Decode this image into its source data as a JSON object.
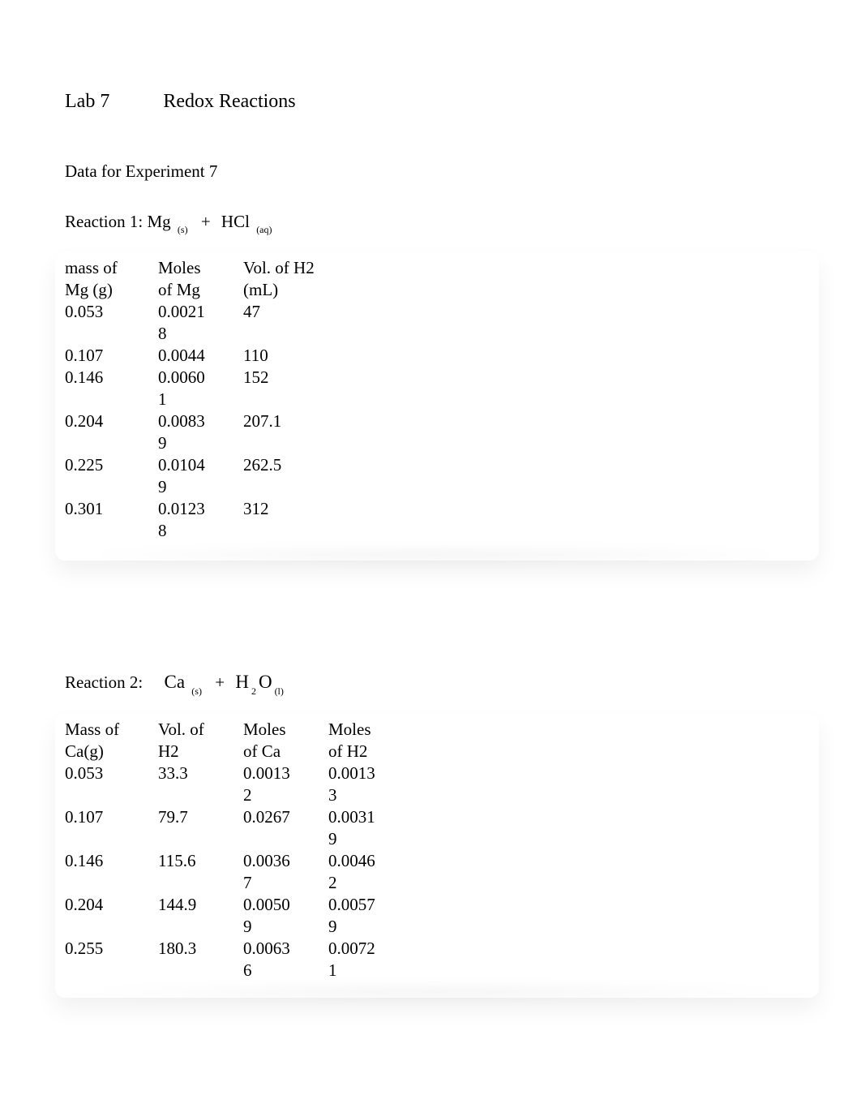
{
  "header": {
    "lab_num": "Lab 7",
    "lab_title": "Redox Reactions"
  },
  "section_title": "Data for Experiment 7",
  "reaction1": {
    "label_prefix": "Reaction 1: Mg",
    "sub1": "(s)",
    "plus": "+",
    "compound2": "HCl",
    "sub2": "(aq)",
    "columns": {
      "mass_header_l1": "mass of",
      "mass_header_l2": "Mg (g)",
      "moles_header_l1": "Moles",
      "moles_header_l2": "of Mg",
      "vol_header_l1": "Vol. of H2",
      "vol_header_l2": "(mL)"
    },
    "rows": [
      {
        "mass": "0.053",
        "moles_l1": "0.0021",
        "moles_l2": "8",
        "vol": "47"
      },
      {
        "mass": "0.107",
        "moles_l1": "0.0044",
        "moles_l2": "",
        "vol": "110"
      },
      {
        "mass": "0.146",
        "moles_l1": "0.0060",
        "moles_l2": "1",
        "vol": "152"
      },
      {
        "mass": "0.204",
        "moles_l1": "0.0083",
        "moles_l2": "9",
        "vol": "207.1"
      },
      {
        "mass": "0.225",
        "moles_l1": "0.0104",
        "moles_l2": "9",
        "vol": "262.5"
      },
      {
        "mass": "0.301",
        "moles_l1": "0.0123",
        "moles_l2": "8",
        "vol": "312"
      }
    ]
  },
  "reaction2": {
    "label_prefix": "Reaction 2:",
    "compound1": "Ca",
    "sub1": "(s)",
    "plus": "+",
    "compound2_part1": "H",
    "compound2_sub2": "2",
    "compound2_part2": "O",
    "sub2": "(l)",
    "columns": {
      "mass_header_l1": "Mass of",
      "mass_header_l2": "Ca(g)",
      "vol_header_l1": "Vol. of",
      "vol_header_l2": "H2",
      "moles_ca_l1": "Moles",
      "moles_ca_l2": "of Ca",
      "moles_h2_l1": "Moles",
      "moles_h2_l2": "of H2"
    },
    "rows": [
      {
        "mass": "0.053",
        "vol": "33.3",
        "moles_ca_l1": "0.0013",
        "moles_ca_l2": "2",
        "moles_h2_l1": "0.0013",
        "moles_h2_l2": "3"
      },
      {
        "mass": "0.107",
        "vol": "79.7",
        "moles_ca_l1": "0.0267",
        "moles_ca_l2": "",
        "moles_h2_l1": "0.0031",
        "moles_h2_l2": "9"
      },
      {
        "mass": "0.146",
        "vol": "115.6",
        "moles_ca_l1": "0.0036",
        "moles_ca_l2": "7",
        "moles_h2_l1": "0.0046",
        "moles_h2_l2": "2"
      },
      {
        "mass": "0.204",
        "vol": "144.9",
        "moles_ca_l1": "0.0050",
        "moles_ca_l2": "9",
        "moles_h2_l1": "0.0057",
        "moles_h2_l2": "9"
      },
      {
        "mass": "0.255",
        "vol": "180.3",
        "moles_ca_l1": "0.0063",
        "moles_ca_l2": "6",
        "moles_h2_l1": "0.0072",
        "moles_h2_l2": "1"
      }
    ]
  }
}
